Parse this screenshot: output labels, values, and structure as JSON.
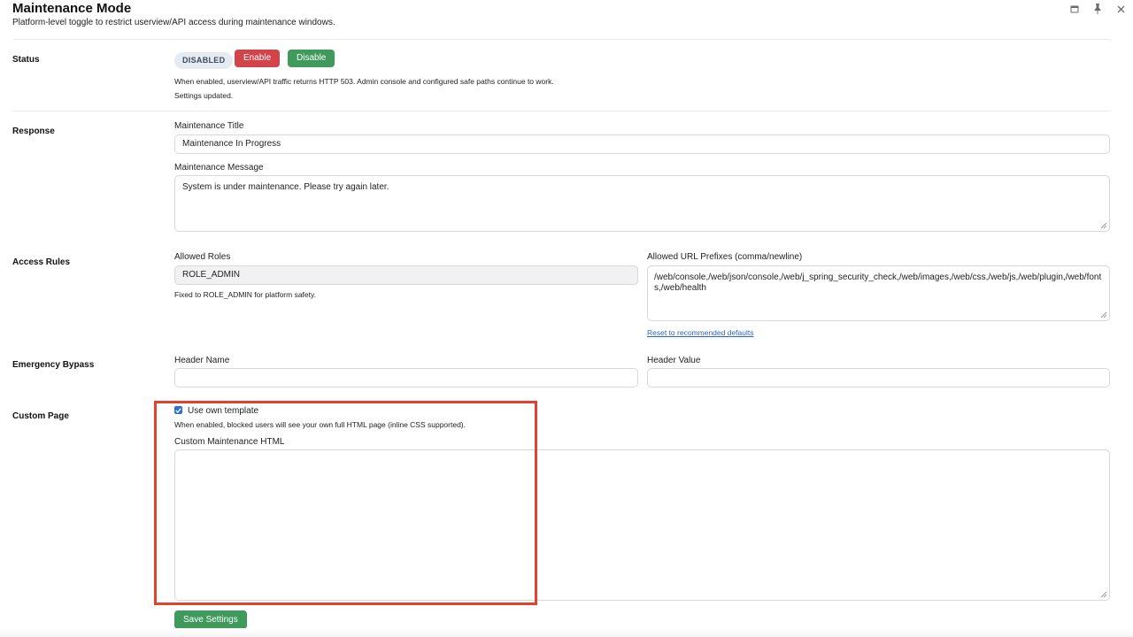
{
  "header": {
    "title": "Maintenance Mode",
    "subtitle": "Platform-level toggle to restrict userview/API access during maintenance windows."
  },
  "window_icons": [
    "panel-icon",
    "pin-icon",
    "close-icon"
  ],
  "status": {
    "label": "Status",
    "badge": "DISABLED",
    "enable_label": "Enable",
    "disable_label": "Disable",
    "note": "When enabled, userview/API traffic returns HTTP 503. Admin console and configured safe paths continue to work.",
    "message": "Settings updated."
  },
  "response": {
    "label": "Response",
    "title_label": "Maintenance Title",
    "title_value": "Maintenance In Progress",
    "message_label": "Maintenance Message",
    "message_value": "System is under maintenance. Please try again later."
  },
  "access_rules": {
    "label": "Access Rules",
    "roles_label": "Allowed Roles",
    "roles_value": "ROLE_ADMIN",
    "roles_note": "Fixed to ROLE_ADMIN for platform safety.",
    "prefixes_label": "Allowed URL Prefixes (comma/newline)",
    "prefixes_value": "/web/console,/web/json/console,/web/j_spring_security_check,/web/images,/web/css,/web/js,/web/plugin,/web/fonts,/web/health",
    "reset_link": "Reset to recommended defaults"
  },
  "bypass": {
    "label": "Emergency Bypass",
    "header_name_label": "Header Name",
    "header_name_value": "",
    "header_value_label": "Header Value",
    "header_value_value": ""
  },
  "custom_page": {
    "label": "Custom Page",
    "checkbox_label": "Use own template",
    "checkbox_checked": true,
    "note": "When enabled, blocked users will see your own full HTML page (inline CSS supported).",
    "html_label": "Custom Maintenance HTML",
    "html_value": ""
  },
  "save_label": "Save Settings",
  "colors": {
    "enable": "#d2434a",
    "disable": "#3f9a5c",
    "highlight": "#e2432e",
    "link": "#2c63c8"
  }
}
